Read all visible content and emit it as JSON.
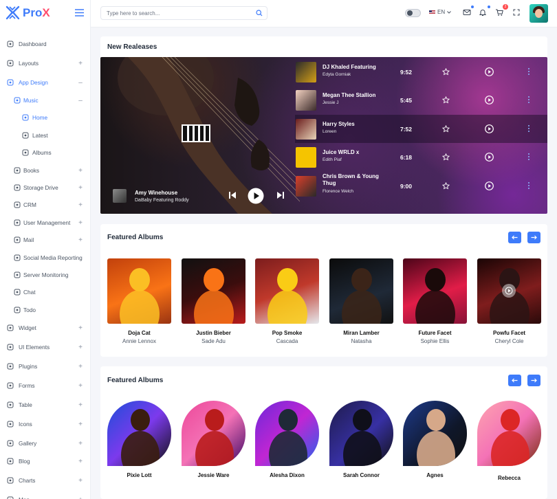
{
  "brand": {
    "name_pre": "Pro",
    "name_post": "X"
  },
  "sidebar": {
    "items": [
      {
        "label": "Dashboard",
        "icon": "dashboard-icon",
        "expand": ""
      },
      {
        "label": "Layouts",
        "icon": "layouts-icon",
        "expand": "+"
      },
      {
        "label": "App Design",
        "icon": "app-design-icon",
        "expand": "–"
      },
      {
        "label": "Music",
        "icon": "music-icon",
        "expand": "–"
      },
      {
        "label": "Home",
        "icon": "home-icon",
        "expand": ""
      },
      {
        "label": "Latest",
        "icon": "latest-icon",
        "expand": ""
      },
      {
        "label": "Albums",
        "icon": "albums-icon",
        "expand": ""
      },
      {
        "label": "Books",
        "icon": "books-icon",
        "expand": "+"
      },
      {
        "label": "Storage Drive",
        "icon": "storage-drive-icon",
        "expand": "+"
      },
      {
        "label": "CRM",
        "icon": "crm-icon",
        "expand": "+"
      },
      {
        "label": "User Management",
        "icon": "user-icon",
        "expand": "+"
      },
      {
        "label": "Mail",
        "icon": "mail-icon",
        "expand": "+"
      },
      {
        "label": "Social Media Reporting",
        "icon": "social-media-icon",
        "expand": ""
      },
      {
        "label": "Server Monitoring",
        "icon": "server-icon",
        "expand": ""
      },
      {
        "label": "Chat",
        "icon": "chat-icon",
        "expand": ""
      },
      {
        "label": "Todo",
        "icon": "todo-icon",
        "expand": ""
      },
      {
        "label": "Widget",
        "icon": "widget-icon",
        "expand": "+"
      },
      {
        "label": "UI Elements",
        "icon": "ui-elements-icon",
        "expand": "+"
      },
      {
        "label": "Plugins",
        "icon": "plugins-icon",
        "expand": "+"
      },
      {
        "label": "Forms",
        "icon": "forms-icon",
        "expand": "+"
      },
      {
        "label": "Table",
        "icon": "table-icon",
        "expand": "+"
      },
      {
        "label": "Icons",
        "icon": "icons-icon",
        "expand": "+"
      },
      {
        "label": "Gallery",
        "icon": "gallery-icon",
        "expand": "+"
      },
      {
        "label": "Blog",
        "icon": "blog-icon",
        "expand": "+"
      },
      {
        "label": "Charts",
        "icon": "charts-icon",
        "expand": "+"
      },
      {
        "label": "Map",
        "icon": "map-icon",
        "expand": "+"
      }
    ]
  },
  "topbar": {
    "search_placeholder": "Type here to search...",
    "language": "EN",
    "cart_count": "2"
  },
  "releases": {
    "title": "New Realeases",
    "now_playing": {
      "title": "Amy Winehouse",
      "subtitle": "DaBaby Featuring Roddy"
    },
    "tracks": [
      {
        "title": "DJ Khaled Featuring",
        "artist": "Edyta Gorniak",
        "duration": "9:52"
      },
      {
        "title": "Megan Thee Stallion",
        "artist": "Jessie J",
        "duration": "5:45"
      },
      {
        "title": "Harry Styles",
        "artist": "Loreen",
        "duration": "7:52"
      },
      {
        "title": "Juice WRLD x",
        "artist": "Edith Piaf",
        "duration": "6:18"
      },
      {
        "title": "Chris Brown & Young Thug",
        "artist": "Florence Welch",
        "duration": "9:00"
      }
    ]
  },
  "featured1": {
    "title": "Featured Albums",
    "albums": [
      {
        "name": "Doja Cat",
        "artist": "Annie Lennox"
      },
      {
        "name": "Justin Bieber",
        "artist": "Sade Adu"
      },
      {
        "name": "Pop Smoke",
        "artist": "Cascada"
      },
      {
        "name": "Miran Lamber",
        "artist": "Natasha"
      },
      {
        "name": "Future Facet",
        "artist": "Sophie Ellis"
      },
      {
        "name": "Powfu Facet",
        "artist": "Cheryl Cole"
      }
    ]
  },
  "featured2": {
    "title": "Featured Albums",
    "albums": [
      {
        "name": "Pixie Lott"
      },
      {
        "name": "Jessie Ware"
      },
      {
        "name": "Alesha Dixon"
      },
      {
        "name": "Sarah Connor"
      },
      {
        "name": "Agnes"
      },
      {
        "name": "Rebecca"
      }
    ]
  },
  "colors": {
    "accent": "#3e7bfa",
    "danger": "#ff4d6d",
    "text": "#1f2937"
  }
}
